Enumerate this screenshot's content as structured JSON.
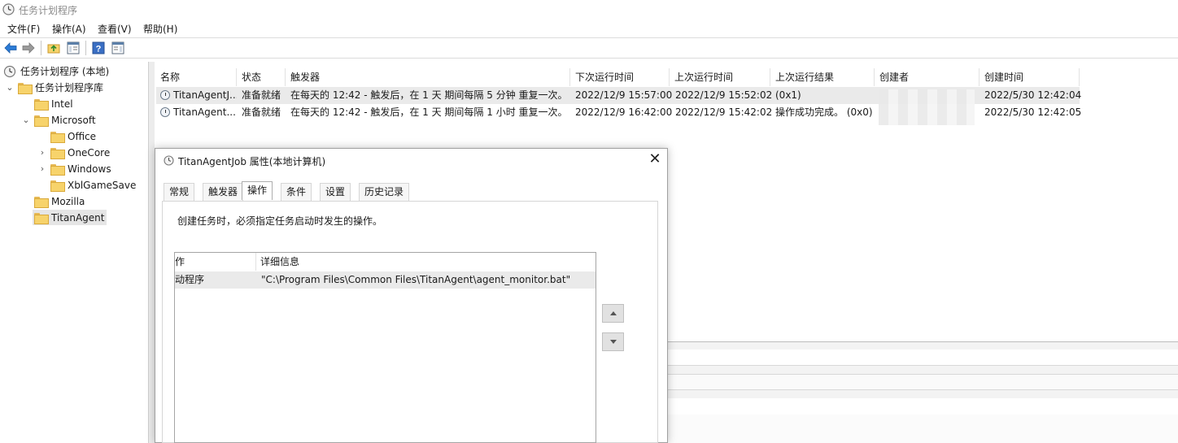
{
  "window": {
    "title": "任务计划程序"
  },
  "menu": [
    "文件(F)",
    "操作(A)",
    "查看(V)",
    "帮助(H)"
  ],
  "toolbar": {
    "buttons": [
      "back-arrow-icon",
      "forward-arrow-icon",
      "up-folder-icon",
      "show-hide-tree-icon",
      "help-icon",
      "show-hide-action-pane-icon"
    ]
  },
  "tree": {
    "root": "任务计划程序 (本地)",
    "library": "任务计划程序库",
    "items": {
      "intel": "Intel",
      "microsoft": "Microsoft",
      "office": "Office",
      "onecore": "OneCore",
      "windows": "Windows",
      "xbl": "XblGameSave",
      "mozilla": "Mozilla",
      "titan": "TitanAgent"
    }
  },
  "list": {
    "columns": [
      "名称",
      "状态",
      "触发器",
      "下次运行时间",
      "上次运行时间",
      "上次运行结果",
      "创建者",
      "创建时间"
    ],
    "rows": [
      {
        "name": "TitanAgentJ...",
        "status": "准备就绪",
        "trigger": "在每天的 12:42 - 触发后，在 1 天 期间每隔 5 分钟 重复一次。",
        "next_run": "2022/12/9 15:57:00",
        "last_run": "2022/12/9 15:52:02",
        "last_result": "(0x1)",
        "created": "2022/5/30 12:42:04"
      },
      {
        "name": "TitanAgent...",
        "status": "准备就绪",
        "trigger": "在每天的 12:42 - 触发后，在 1 天 期间每隔 1 小时 重复一次。",
        "next_run": "2022/12/9 16:42:00",
        "last_run": "2022/12/9 15:42:02",
        "last_result": "操作成功完成。 (0x0)",
        "created": "2022/5/30 12:42:05"
      }
    ]
  },
  "dialog": {
    "title": "TitanAgentJob 属性(本地计算机)",
    "tabs": [
      "常规",
      "触发器",
      "操作",
      "条件",
      "设置",
      "历史记录"
    ],
    "active_tab": "操作",
    "description": "创建任务时，必须指定任务启动时发生的操作。",
    "table": {
      "col_action": "作",
      "col_details": "详细信息",
      "rows": [
        {
          "action": "动程序",
          "details": "\"C:\\Program Files\\Common Files\\TitanAgent\\agent_monitor.bat\""
        }
      ]
    },
    "close_glyph": "✕"
  }
}
